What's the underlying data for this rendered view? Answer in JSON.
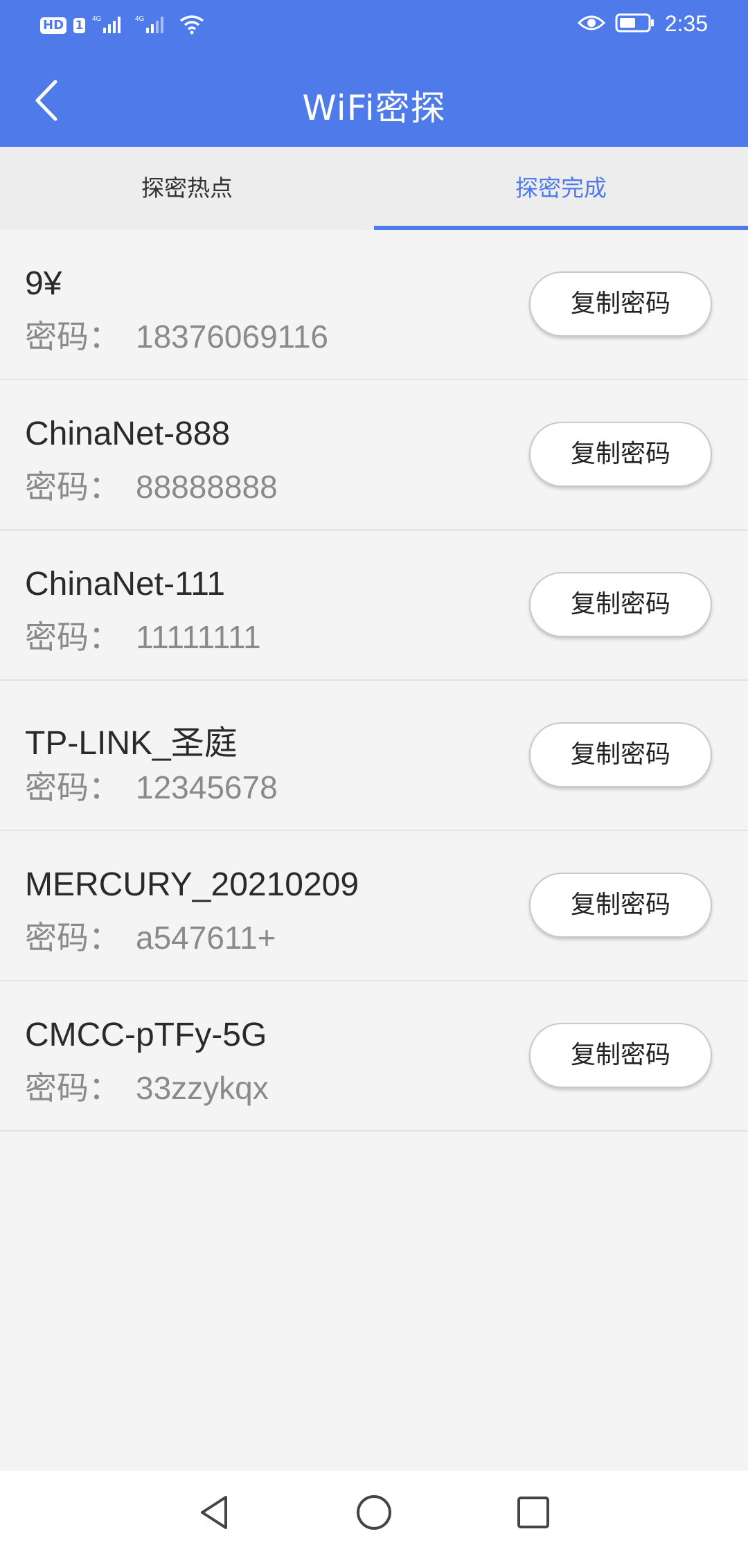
{
  "status_bar": {
    "hd": "HD",
    "sim": "1",
    "net1": "4G",
    "net2": "4G",
    "time": "2:35",
    "icons": [
      "signal-icon",
      "wifi-icon",
      "eye-icon",
      "battery-icon"
    ]
  },
  "app_bar": {
    "title": "WiFi密探",
    "back_icon": "chevron-left-icon"
  },
  "tabs": [
    {
      "label": "探密热点",
      "active": false
    },
    {
      "label": "探密完成",
      "active": true
    }
  ],
  "list": {
    "password_label": "密码：",
    "copy_label": "复制密码",
    "items": [
      {
        "ssid": "9¥",
        "password": "18376069116"
      },
      {
        "ssid": "ChinaNet-888",
        "password": "88888888"
      },
      {
        "ssid": "ChinaNet-111",
        "password": "11111111"
      },
      {
        "ssid": "TP-LINK_圣庭",
        "password": "12345678"
      },
      {
        "ssid": "MERCURY_20210209",
        "password": "a547611+"
      },
      {
        "ssid": "CMCC-pTFy-5G",
        "password": "33zzykqx"
      }
    ]
  },
  "nav_bar": {
    "icons": [
      "back-triangle-icon",
      "home-circle-icon",
      "recents-square-icon"
    ]
  },
  "colors": {
    "accent": "#4f7ae9",
    "background": "#f4f4f4",
    "tab_bar": "#ededed"
  }
}
